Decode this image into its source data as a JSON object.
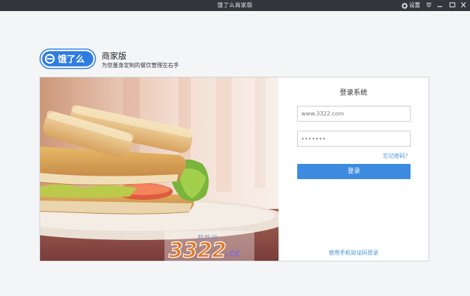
{
  "window": {
    "title": "饿了么商家版",
    "settings_label": "设置"
  },
  "brand": {
    "logo_text": "饿了么",
    "name": "商家版",
    "slogan": "为您量身定制的餐饮管理左右手"
  },
  "login": {
    "title": "登录系统",
    "username_placeholder": "www.3322.com",
    "password_value": "•••••••",
    "forgot_label": "忘记密码？",
    "submit_label": "登录",
    "sms_login_label": "使用手机验证码登录"
  },
  "watermark": {
    "site": "软件站",
    "number": "3322",
    "domain": ".cc"
  },
  "colors": {
    "titlebar": "#33363d",
    "primary": "#3d8be0",
    "link": "#4a8fd8",
    "logo_blue": "#2f7de1"
  }
}
